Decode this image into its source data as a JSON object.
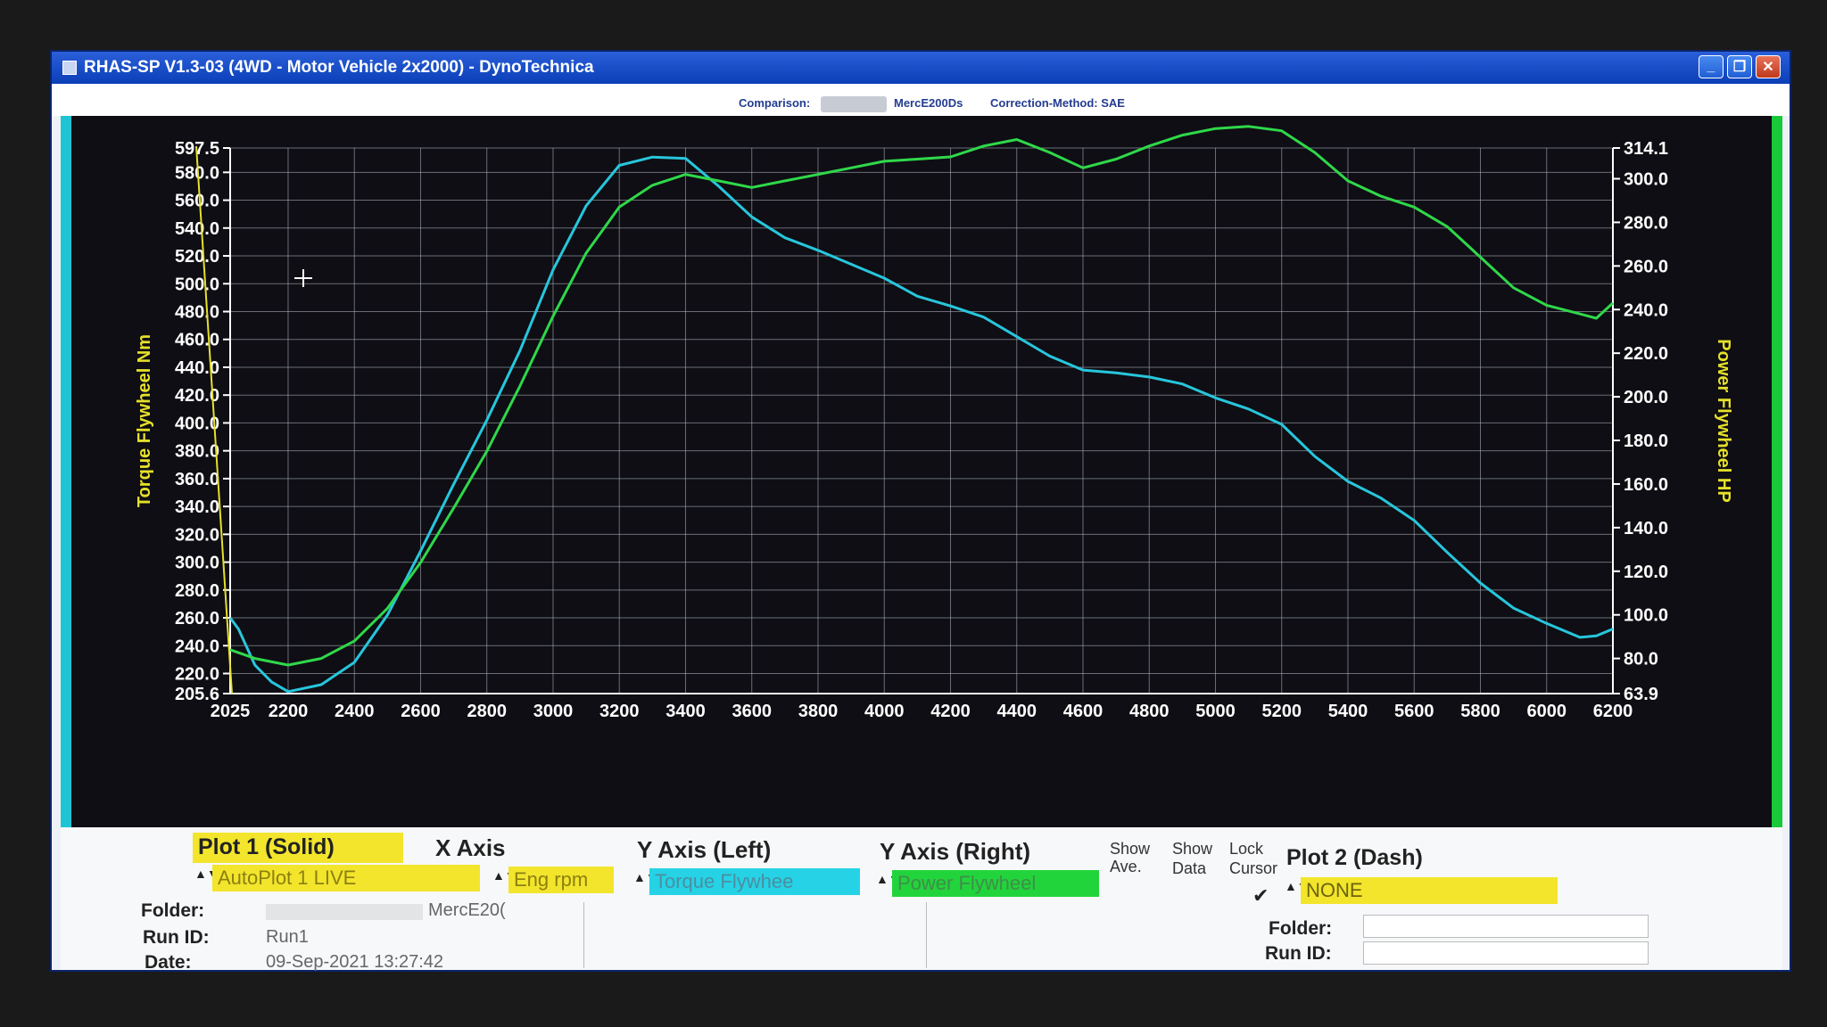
{
  "window": {
    "title": "RHAS-SP V1.3-03  (4WD - Motor Vehicle 2x2000) - DynoTechnica",
    "buttons": {
      "minimize": "_",
      "restore": "❐",
      "close": "✕"
    }
  },
  "info_bar": {
    "comparison_label": "Comparison:",
    "comparison_value": "MercE200Ds",
    "correction": "Correction-Method: SAE"
  },
  "chart_data": {
    "type": "line",
    "ylabel_left": "Torque Flywheel Nm",
    "ylabel_right": "Power Flywheel HP",
    "xlabel": "",
    "xlim": [
      2025,
      6200
    ],
    "ylim_left": [
      205.6,
      597.5
    ],
    "ylim_right": [
      63.9,
      314.1
    ],
    "x_ticks": [
      "2025",
      "2200",
      "2400",
      "2600",
      "2800",
      "3000",
      "3200",
      "3400",
      "3600",
      "3800",
      "4000",
      "4200",
      "4400",
      "4600",
      "4800",
      "5000",
      "5200",
      "5400",
      "5600",
      "5800",
      "6000",
      "6200"
    ],
    "y_ticks_left": [
      "597.5",
      "580.0",
      "560.0",
      "540.0",
      "520.0",
      "500.0",
      "480.0",
      "460.0",
      "440.0",
      "420.0",
      "400.0",
      "380.0",
      "360.0",
      "340.0",
      "320.0",
      "300.0",
      "280.0",
      "260.0",
      "240.0",
      "220.0",
      "205.6"
    ],
    "y_ticks_right": [
      "314.1",
      "300.0",
      "280.0",
      "260.0",
      "240.0",
      "220.0",
      "200.0",
      "180.0",
      "160.0",
      "140.0",
      "120.0",
      "100.0",
      "80.0",
      "63.9"
    ],
    "marker_x": 2025,
    "grid": true,
    "series": [
      {
        "name": "Torque Flywheel",
        "axis": "left",
        "color": "#27c6dc",
        "x": [
          2025,
          2050,
          2100,
          2150,
          2200,
          2300,
          2400,
          2500,
          2600,
          2700,
          2800,
          2900,
          3000,
          3100,
          3200,
          3300,
          3400,
          3500,
          3600,
          3700,
          3800,
          3900,
          4000,
          4100,
          4200,
          4300,
          4400,
          4500,
          4600,
          4700,
          4800,
          4900,
          5000,
          5100,
          5200,
          5300,
          5400,
          5500,
          5600,
          5700,
          5800,
          5900,
          6000,
          6100,
          6150,
          6200
        ],
        "y": [
          260,
          252,
          226,
          214,
          207,
          212,
          228,
          262,
          308,
          356,
          402,
          452,
          510,
          556,
          585,
          591,
          590,
          570,
          548,
          533,
          524,
          514,
          504,
          491,
          484,
          476,
          462,
          448,
          438,
          436,
          433,
          428,
          418,
          410,
          399,
          376,
          358,
          346,
          330,
          307,
          285,
          267,
          256,
          246,
          247,
          252
        ]
      },
      {
        "name": "Power Flywheel",
        "axis": "right",
        "color": "#2fd84a",
        "x": [
          2025,
          2100,
          2200,
          2300,
          2400,
          2500,
          2600,
          2700,
          2800,
          2900,
          3000,
          3100,
          3200,
          3300,
          3400,
          3500,
          3600,
          3700,
          3800,
          3900,
          4000,
          4100,
          4200,
          4300,
          4400,
          4500,
          4600,
          4700,
          4800,
          4900,
          5000,
          5100,
          5200,
          5300,
          5400,
          5500,
          5600,
          5700,
          5800,
          5900,
          6000,
          6100,
          6150,
          6200
        ],
        "y": [
          84,
          80,
          77,
          80,
          88,
          103,
          124,
          149,
          175,
          205,
          237,
          266,
          287,
          297,
          302,
          299,
          296,
          299,
          302,
          305,
          308,
          309,
          310,
          315,
          318,
          312,
          305,
          309,
          315,
          320,
          323,
          324,
          322,
          312,
          299,
          292,
          287,
          278,
          264,
          250,
          242,
          238,
          236,
          243
        ]
      }
    ]
  },
  "panel": {
    "plot1": {
      "title": "Plot 1 (Solid)",
      "run_select": "AutoPlot 1 LIVE",
      "folder_label": "Folder:",
      "folder_value": "MercE20(",
      "run_id_label": "Run ID:",
      "run_id_value": "Run1",
      "date_label": "Date:",
      "date_value": "09-Sep-2021  13:27:42"
    },
    "x_axis": {
      "title": "X Axis",
      "value": "Eng rpm"
    },
    "y_axis_left": {
      "title": "Y Axis (Left)",
      "value": "Torque Flywhee"
    },
    "y_axis_right": {
      "title": "Y Axis (Right)",
      "value": "Power Flywheel"
    },
    "show_ave": {
      "line1": "Show",
      "line2": "Ave."
    },
    "show_data": {
      "line1": "Show",
      "line2": "Data"
    },
    "lock_cursor": {
      "line1": "Lock",
      "line2": "Cursor",
      "checkmark": "✔"
    },
    "plot2": {
      "title": "Plot 2 (Dash)",
      "run_select": "NONE",
      "folder_label": "Folder:",
      "run_id_label": "Run ID:",
      "date_label": "Date:"
    },
    "colors": {
      "yellow": "#f2e52c",
      "cyan": "#26d2e6",
      "green": "#22d43c"
    },
    "spin_glyph": "▲▼"
  }
}
